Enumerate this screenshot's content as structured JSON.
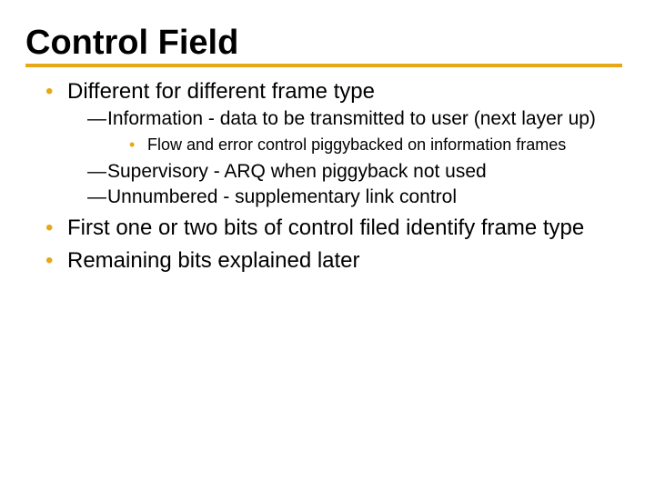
{
  "title": "Control Field",
  "bullets": {
    "b1": "Different for different frame type",
    "b1_d1": "Information - data to be transmitted to user (next layer up)",
    "b1_d1_s1": "Flow and error control piggybacked on information frames",
    "b1_d2": "Supervisory - ARQ when piggyback not used",
    "b1_d3": "Unnumbered - supplementary link control",
    "b2": "First one or two bits of control filed identify frame type",
    "b3": "Remaining bits explained later"
  }
}
